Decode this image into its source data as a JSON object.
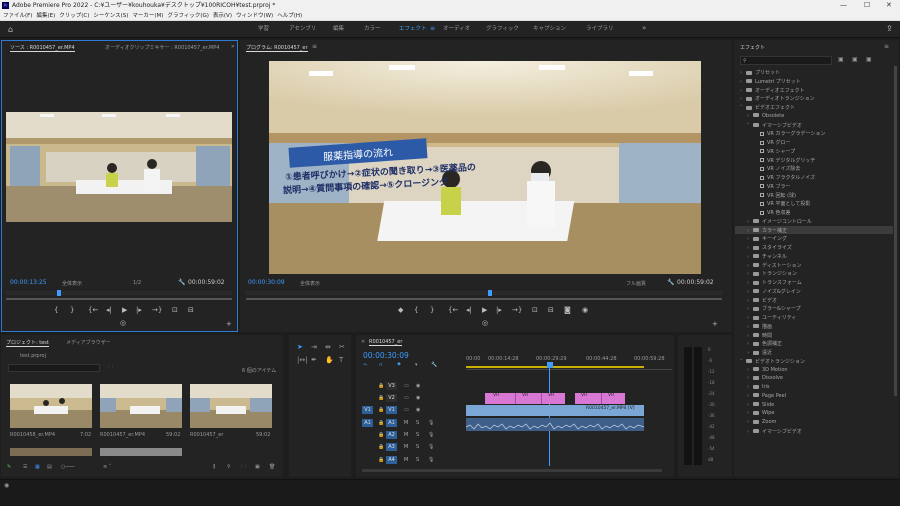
{
  "window": {
    "title": "Adobe Premiere Pro 2022 - C:¥ユーザー¥kouhouka¥デスクトップ¥100RICOH¥test.prproj *",
    "controls": [
      "—",
      "☐",
      "✕"
    ]
  },
  "menu": [
    "ファイル(F)",
    "編集(E)",
    "クリップ(C)",
    "シーケンス(S)",
    "マーカー(M)",
    "グラフィック(G)",
    "表示(V)",
    "ウィンドウ(W)",
    "ヘルプ(H)"
  ],
  "workspaces": [
    {
      "label": "学習",
      "active": false
    },
    {
      "label": "アセンブリ",
      "active": false
    },
    {
      "label": "編集",
      "active": false
    },
    {
      "label": "カラー",
      "active": false
    },
    {
      "label": "エフェクト",
      "active": true
    },
    {
      "label": "オーディオ",
      "active": false
    },
    {
      "label": "グラフィック",
      "active": false
    },
    {
      "label": "キャプション",
      "active": false
    },
    {
      "label": "ライブラリ",
      "active": false
    }
  ],
  "source": {
    "tabs": [
      "ソース : R0010457_er.MP4",
      "オーディオクリップミキサー : R0010457_er.MP4"
    ],
    "timecode": "00:00:13:25",
    "fit": "全体表示",
    "resolution": "1/2",
    "duration": "00:00:59:02"
  },
  "program": {
    "tab": "プログラム: R0010457_er",
    "timecode": "00:00:30:09",
    "fit": "全体表示",
    "quality": "フル画質",
    "duration": "00:00:59:02",
    "overlay_title": "服薬指導の流れ",
    "overlay_line1": "①患者呼びかけ→②症状の聞き取り→③医薬品の",
    "overlay_line2": "説明→④質問事項の確認→⑤クロージング"
  },
  "project": {
    "tabs": [
      "プロジェクト: test",
      "メディアブラウザー"
    ],
    "file": "test.prproj",
    "item_count": "6 個のアイテム",
    "thumbs": [
      {
        "name": "R0010458_er.MP4",
        "duration": "7:02"
      },
      {
        "name": "R0010457_er.MP4",
        "duration": "59:02"
      },
      {
        "name": "R0010457_er",
        "duration": "59:02"
      }
    ]
  },
  "timeline": {
    "tab": "R0010457_er",
    "timecode": "00:00:30:09",
    "ruler": [
      "00:00",
      "00:00:14:28",
      "00:00:29:29",
      "00:00:44:28",
      "00:00:59:28"
    ],
    "tracks": [
      {
        "target": "",
        "name": "V3"
      },
      {
        "target": "",
        "name": "V2"
      },
      {
        "target": "V1",
        "name": "V1"
      },
      {
        "target": "A1",
        "name": "A1"
      },
      {
        "target": "",
        "name": "A2"
      },
      {
        "target": "",
        "name": "A3"
      },
      {
        "target": "",
        "name": "A4"
      }
    ],
    "vr_label": "VR",
    "main_clip": "R0010457_er.MP4 [V]"
  },
  "meters": [
    "0",
    "-6",
    "-12",
    "-18",
    "-24",
    "-30",
    "-36",
    "-42",
    "-48",
    "-54",
    "dB"
  ],
  "effects": {
    "title": "エフェクト",
    "items": [
      {
        "label": "プリセット",
        "level": 0,
        "kind": "folder"
      },
      {
        "label": "Lumetri プリセット",
        "level": 0,
        "kind": "folder"
      },
      {
        "label": "オーディオエフェクト",
        "level": 0,
        "kind": "folder"
      },
      {
        "label": "オーディオトランジション",
        "level": 0,
        "kind": "folder"
      },
      {
        "label": "ビデオエフェクト",
        "level": 0,
        "kind": "folder",
        "open": true
      },
      {
        "label": "Obsolete",
        "level": 1,
        "kind": "folder"
      },
      {
        "label": "イマーシブビデオ",
        "level": 1,
        "kind": "folder",
        "open": true
      },
      {
        "label": "VR カラーグラデーション",
        "level": 2,
        "kind": "fx"
      },
      {
        "label": "VR グロー",
        "level": 2,
        "kind": "fx"
      },
      {
        "label": "VR シャープ",
        "level": 2,
        "kind": "fx"
      },
      {
        "label": "VR デジタルグリッチ",
        "level": 2,
        "kind": "fx"
      },
      {
        "label": "VR ノイズ除去",
        "level": 2,
        "kind": "fx"
      },
      {
        "label": "VR フラクタルノイズ",
        "level": 2,
        "kind": "fx"
      },
      {
        "label": "VR ブラー",
        "level": 2,
        "kind": "fx"
      },
      {
        "label": "VR 回転 (球)",
        "level": 2,
        "kind": "fx"
      },
      {
        "label": "VR 平面として投影",
        "level": 2,
        "kind": "fx"
      },
      {
        "label": "VR 色収差",
        "level": 2,
        "kind": "fx"
      },
      {
        "label": "イメージコントロール",
        "level": 1,
        "kind": "folder"
      },
      {
        "label": "カラー補正",
        "level": 1,
        "kind": "folder",
        "highlight": true
      },
      {
        "label": "キーイング",
        "level": 1,
        "kind": "folder"
      },
      {
        "label": "スタイライズ",
        "level": 1,
        "kind": "folder"
      },
      {
        "label": "チャンネル",
        "level": 1,
        "kind": "folder"
      },
      {
        "label": "ディストーション",
        "level": 1,
        "kind": "folder"
      },
      {
        "label": "トランジション",
        "level": 1,
        "kind": "folder"
      },
      {
        "label": "トランスフォーム",
        "level": 1,
        "kind": "folder"
      },
      {
        "label": "ノイズ&グレイン",
        "level": 1,
        "kind": "folder"
      },
      {
        "label": "ビデオ",
        "level": 1,
        "kind": "folder"
      },
      {
        "label": "ブラー&シャープ",
        "level": 1,
        "kind": "folder"
      },
      {
        "label": "ユーティリティ",
        "level": 1,
        "kind": "folder"
      },
      {
        "label": "描画",
        "level": 1,
        "kind": "folder"
      },
      {
        "label": "時間",
        "level": 1,
        "kind": "folder"
      },
      {
        "label": "色調補正",
        "level": 1,
        "kind": "folder"
      },
      {
        "label": "遠近",
        "level": 1,
        "kind": "folder"
      },
      {
        "label": "ビデオトランジション",
        "level": 0,
        "kind": "folder",
        "open": true
      },
      {
        "label": "3D Motion",
        "level": 1,
        "kind": "folder"
      },
      {
        "label": "Dissolve",
        "level": 1,
        "kind": "folder"
      },
      {
        "label": "Iris",
        "level": 1,
        "kind": "folder"
      },
      {
        "label": "Page Peel",
        "level": 1,
        "kind": "folder"
      },
      {
        "label": "Slide",
        "level": 1,
        "kind": "folder"
      },
      {
        "label": "Wipe",
        "level": 1,
        "kind": "folder"
      },
      {
        "label": "Zoom",
        "level": 1,
        "kind": "folder"
      },
      {
        "label": "イマーシブビデオ",
        "level": 1,
        "kind": "folder"
      }
    ]
  },
  "colors": {
    "accent": "#3d9cff",
    "vr_clip": "#d977d4",
    "video_clip": "#7aa7d6",
    "audio_clip": "#3d5f8a",
    "playhead": "#3d9cff"
  }
}
